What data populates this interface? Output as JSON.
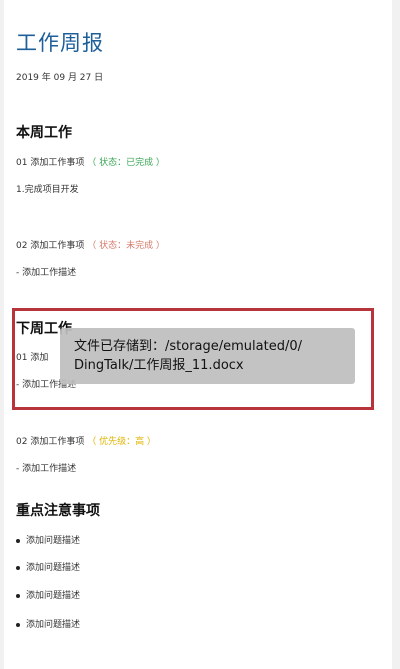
{
  "document": {
    "title": "工作周报",
    "date": "2019 年 09 月 27 日",
    "this_week": {
      "heading": "本周工作",
      "items": [
        {
          "label": "01 添加工作事项",
          "status": "（ 状态：已完成 ）",
          "desc": "1.完成项目开发"
        },
        {
          "label": "02 添加工作事项",
          "status": "（ 状态：未完成 ）",
          "desc": "- 添加工作描述"
        }
      ]
    },
    "next_week": {
      "heading": "下周工作",
      "item1_label": "01 添加",
      "item1_desc": "- 添加工作描述",
      "item2_label": "02 添加工作事项",
      "item2_status": "（ 优先级：高 ）",
      "item2_desc": "- 添加工作描述"
    },
    "notes": {
      "heading": "重点注意事项",
      "items": [
        "添加问题描述",
        "添加问题描述",
        "添加问题描述",
        "添加问题描述"
      ]
    }
  },
  "toast": {
    "line1": "文件已存储到：/storage/emulated/0/",
    "line2": "DingTalk/工作周报_11.docx"
  },
  "colors": {
    "title": "#1f5f99",
    "done": "#3aa655",
    "todo": "#d67a6a",
    "priority": "#e0b400",
    "highlight_border": "#b7343b"
  }
}
